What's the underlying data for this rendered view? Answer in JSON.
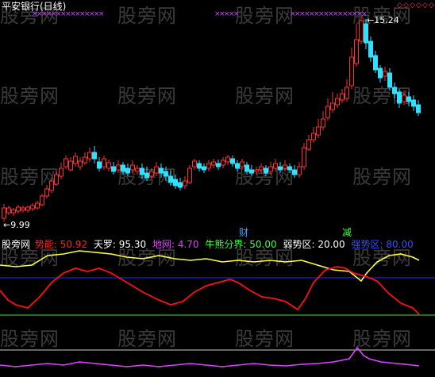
{
  "window_title": "平安银行(日线)",
  "price": {
    "high_label": "15.24",
    "low_label": "9.99"
  },
  "markers": {
    "marker_a": "财",
    "marker_b": "减"
  },
  "indicator": {
    "site": "股旁网",
    "items": [
      {
        "key": "dongneng",
        "label": "势能:",
        "value": "50.92",
        "color": "#ff2020"
      },
      {
        "key": "tianluo",
        "label": "天罗:",
        "value": "95.30",
        "color": "#ffffff"
      },
      {
        "key": "diwang",
        "label": "地网:",
        "value": "4.70",
        "color": "#e040ff"
      },
      {
        "key": "niuxiong",
        "label": "牛熊分界:",
        "value": "50.00",
        "color": "#40ff40"
      },
      {
        "key": "ruoshi",
        "label": "弱势区:",
        "value": "20.00",
        "color": "#ffffff"
      },
      {
        "key": "qiangshi",
        "label": "强势区:",
        "value": "80.00",
        "color": "#3050ff"
      }
    ]
  },
  "watermark": "股旁网",
  "colors": {
    "background": "#000000",
    "up": "#ff3030",
    "down": "#30e0ff",
    "yellow_line": "#ffff40",
    "red_line": "#ff1010",
    "blue_line": "#2030ff",
    "green_line": "#40e040",
    "magenta_line": "#e040ff",
    "x_markers": "#d040ff"
  }
}
